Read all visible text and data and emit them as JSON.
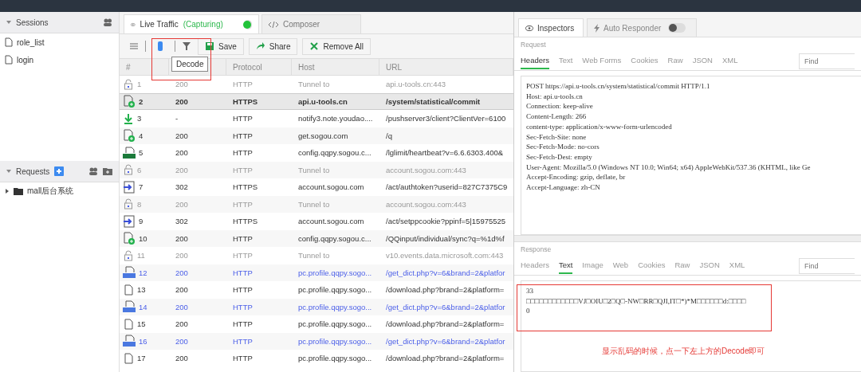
{
  "sidebar": {
    "sessions": {
      "title": "Sessions",
      "items": [
        "role_list",
        "login"
      ]
    },
    "requests": {
      "title": "Requests",
      "tree": [
        {
          "label": "mall后台系统",
          "expanded": false
        }
      ]
    }
  },
  "traffic_tabs": [
    {
      "label": "Live Traffic",
      "status": "(Capturing)",
      "capturing": true,
      "selected": true
    },
    {
      "label": "Composer",
      "selected": false
    }
  ],
  "toolbar": {
    "buttons": [
      {
        "kind": "save",
        "label": "Save"
      },
      {
        "kind": "share",
        "label": "Share"
      },
      {
        "kind": "remove",
        "label": "Remove All"
      }
    ],
    "tooltip": "Decode"
  },
  "table": {
    "columns": [
      "#",
      "",
      "Protocol",
      "Host",
      "URL"
    ],
    "rows": [
      {
        "kind": "lock",
        "selected": false,
        "cells": [
          "1",
          "200",
          "HTTP",
          "Tunnel to",
          "api.u-tools.cn:443"
        ]
      },
      {
        "kind": "doc-plus",
        "selected": true,
        "cells": [
          "2",
          "200",
          "HTTPS",
          "api.u-tools.cn",
          "/system/statistical/commit"
        ]
      },
      {
        "kind": "download",
        "selected": false,
        "cells": [
          "3",
          "-",
          "HTTP",
          "notify3.note.youdao....",
          "/pushserver3/client?ClientVer=6100"
        ]
      },
      {
        "kind": "doc-plus",
        "selected": false,
        "cells": [
          "4",
          "200",
          "HTTP",
          "get.sogou.com",
          "/q"
        ]
      },
      {
        "kind": "json",
        "selected": false,
        "cells": [
          "5",
          "200",
          "HTTP",
          "config.qqpy.sogou.c...",
          "/lglimit/heartbeat?v=6.6.6303.400&"
        ]
      },
      {
        "kind": "lock",
        "selected": false,
        "cells": [
          "6",
          "200",
          "HTTP",
          "Tunnel to",
          "account.sogou.com:443"
        ]
      },
      {
        "kind": "redirect",
        "selected": false,
        "cells": [
          "7",
          "302",
          "HTTPS",
          "account.sogou.com",
          "/act/authtoken?userid=827C7375C9"
        ]
      },
      {
        "kind": "lock",
        "selected": false,
        "cells": [
          "8",
          "200",
          "HTTP",
          "Tunnel to",
          "account.sogou.com:443"
        ]
      },
      {
        "kind": "redirect",
        "selected": false,
        "cells": [
          "9",
          "302",
          "HTTPS",
          "account.sogou.com",
          "/act/setppcookie?ppinf=5|15975525"
        ]
      },
      {
        "kind": "doc-plus",
        "selected": false,
        "cells": [
          "10",
          "200",
          "HTTP",
          "config.qqpy.sogou.c...",
          "/QQinput/individual/sync?q=%1d%f"
        ]
      },
      {
        "kind": "lock",
        "selected": false,
        "cells": [
          "11",
          "200",
          "HTTP",
          "Tunnel to",
          "v10.events.data.microsoft.com:443"
        ]
      },
      {
        "kind": "html",
        "selected": false,
        "cells": [
          "12",
          "200",
          "HTTP",
          "pc.profile.qqpy.sogo...",
          "/get_dict.php?v=6&brand=2&platfor"
        ]
      },
      {
        "kind": "doc",
        "selected": false,
        "cells": [
          "13",
          "200",
          "HTTP",
          "pc.profile.qqpy.sogo...",
          "/download.php?brand=2&platform="
        ]
      },
      {
        "kind": "html",
        "selected": false,
        "cells": [
          "14",
          "200",
          "HTTP",
          "pc.profile.qqpy.sogo...",
          "/get_dict.php?v=6&brand=2&platfor"
        ]
      },
      {
        "kind": "doc",
        "selected": false,
        "cells": [
          "15",
          "200",
          "HTTP",
          "pc.profile.qqpy.sogo...",
          "/download.php?brand=2&platform="
        ]
      },
      {
        "kind": "html",
        "selected": false,
        "cells": [
          "16",
          "200",
          "HTTP",
          "pc.profile.qqpy.sogo...",
          "/get_dict.php?v=6&brand=2&platfor"
        ]
      },
      {
        "kind": "doc",
        "selected": false,
        "cells": [
          "17",
          "200",
          "HTTP",
          "pc.profile.qqpy.sogo...",
          "/download.php?brand=2&platform="
        ]
      }
    ]
  },
  "inspector_tabs": [
    {
      "label": "Inspectors",
      "selected": true
    },
    {
      "label": "Auto Responder",
      "selected": false,
      "on": false
    }
  ],
  "request": {
    "label": "Request",
    "tabs": [
      {
        "label": "Headers",
        "selected": true
      },
      {
        "label": "Text",
        "selected": false
      },
      {
        "label": "Web Forms",
        "selected": false
      },
      {
        "label": "Cookies",
        "selected": false
      },
      {
        "label": "Raw",
        "selected": false
      },
      {
        "label": "JSON",
        "selected": false
      },
      {
        "label": "XML",
        "selected": false
      }
    ],
    "find_placeholder": "Find",
    "lines": [
      "POST https://api.u-tools.cn/system/statistical/commit HTTP/1.1",
      "Host: api.u-tools.cn",
      "Connection: keep-alive",
      "Content-Length: 266",
      "content-type: application/x-www-form-urlencoded",
      "Sec-Fetch-Site: none",
      "Sec-Fetch-Mode: no-cors",
      "Sec-Fetch-Dest: empty",
      "User-Agent: Mozilla/5.0 (Windows NT 10.0; Win64; x64) AppleWebKit/537.36 (KHTML, like Ge",
      "Accept-Encoding: gzip, deflate, br",
      "Accept-Language: zh-CN"
    ]
  },
  "response": {
    "label": "Response",
    "tabs": [
      {
        "label": "Headers",
        "selected": false
      },
      {
        "label": "Text",
        "selected": true
      },
      {
        "label": "Image",
        "selected": false
      },
      {
        "label": "Web",
        "selected": false
      },
      {
        "label": "Cookies",
        "selected": false
      },
      {
        "label": "Raw",
        "selected": false
      },
      {
        "label": "JSON",
        "selected": false
      },
      {
        "label": "XML",
        "selected": false
      }
    ],
    "find_placeholder": "Find",
    "lines": [
      "33",
      "□□□□□□□□□□□□VJ□OIU□2□Q□-NW□RR□QJI,IT□*)*M□□□□□□d:□□□□",
      "0"
    ]
  },
  "annotation": "显示乱码的时候，点一下左上方的Decode即可"
}
